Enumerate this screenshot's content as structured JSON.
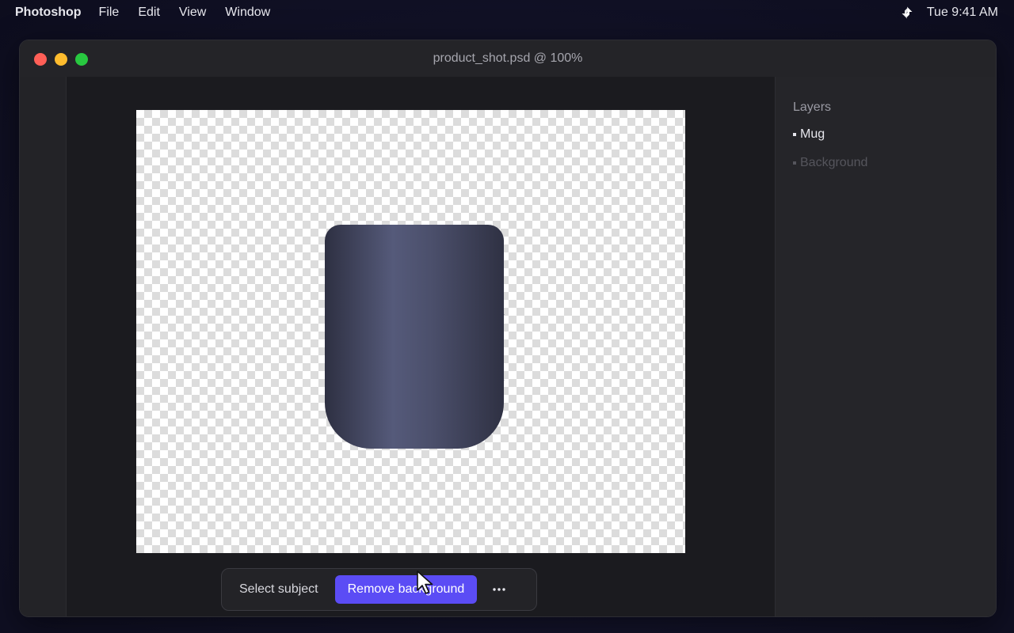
{
  "menubar": {
    "app_name": "Photoshop",
    "items": [
      "File",
      "Edit",
      "View",
      "Window"
    ],
    "clock": "Tue 9:41 AM"
  },
  "window": {
    "title": "product_shot.psd @ 100%"
  },
  "context_bar": {
    "select_subject_label": "Select subject",
    "remove_background_label": "Remove background",
    "more_icon": "ellipsis-icon"
  },
  "layers_panel": {
    "title": "Layers",
    "layers": [
      {
        "name": "Mug",
        "active": true
      },
      {
        "name": "Background",
        "active": false
      }
    ]
  },
  "colors": {
    "accent": "#5b4cf5",
    "close": "#ff5f57",
    "minimize": "#febc2e",
    "maximize": "#28c840",
    "mug": "#3a3d52"
  }
}
